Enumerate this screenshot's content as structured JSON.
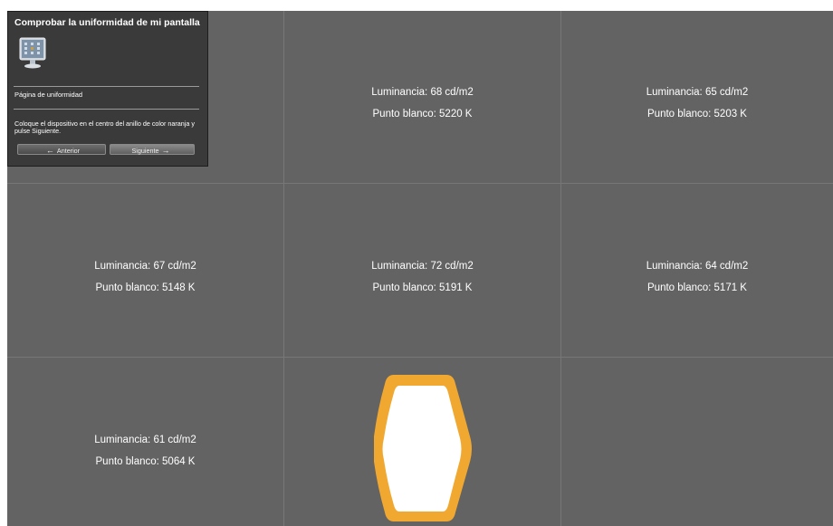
{
  "panel": {
    "title": "Comprobar la uniformidad de mi pantalla",
    "subtitle": "Página de uniformidad",
    "instructions": "Coloque el dispositivo en el centro del anillo de color naranja y pulse Siguiente.",
    "prev_label": "Anterior",
    "next_label": "Siguiente",
    "icon": "monitor-icon"
  },
  "grid": {
    "r1c2": {
      "luminance": "Luminancia:  68 cd/m2",
      "white_point": "Punto blanco:  5220 K"
    },
    "r1c3": {
      "luminance": "Luminancia:  65 cd/m2",
      "white_point": "Punto blanco:  5203 K"
    },
    "r2c1": {
      "luminance": "Luminancia:  67 cd/m2",
      "white_point": "Punto blanco:  5148 K"
    },
    "r2c2": {
      "luminance": "Luminancia:  72 cd/m2",
      "white_point": "Punto blanco:  5191 K"
    },
    "r2c3": {
      "luminance": "Luminancia:  64 cd/m2",
      "white_point": "Punto blanco:  5171 K"
    },
    "r3c1": {
      "luminance": "Luminancia:  61 cd/m2",
      "white_point": "Punto blanco:  5064 K"
    }
  },
  "target": {
    "active_cell": "r3c2",
    "ring_color": "#f0a830",
    "fill_color": "#ffffff"
  },
  "colors": {
    "background": "#636363",
    "grid_line": "#777777",
    "panel_bg": "#3a3a3a"
  }
}
